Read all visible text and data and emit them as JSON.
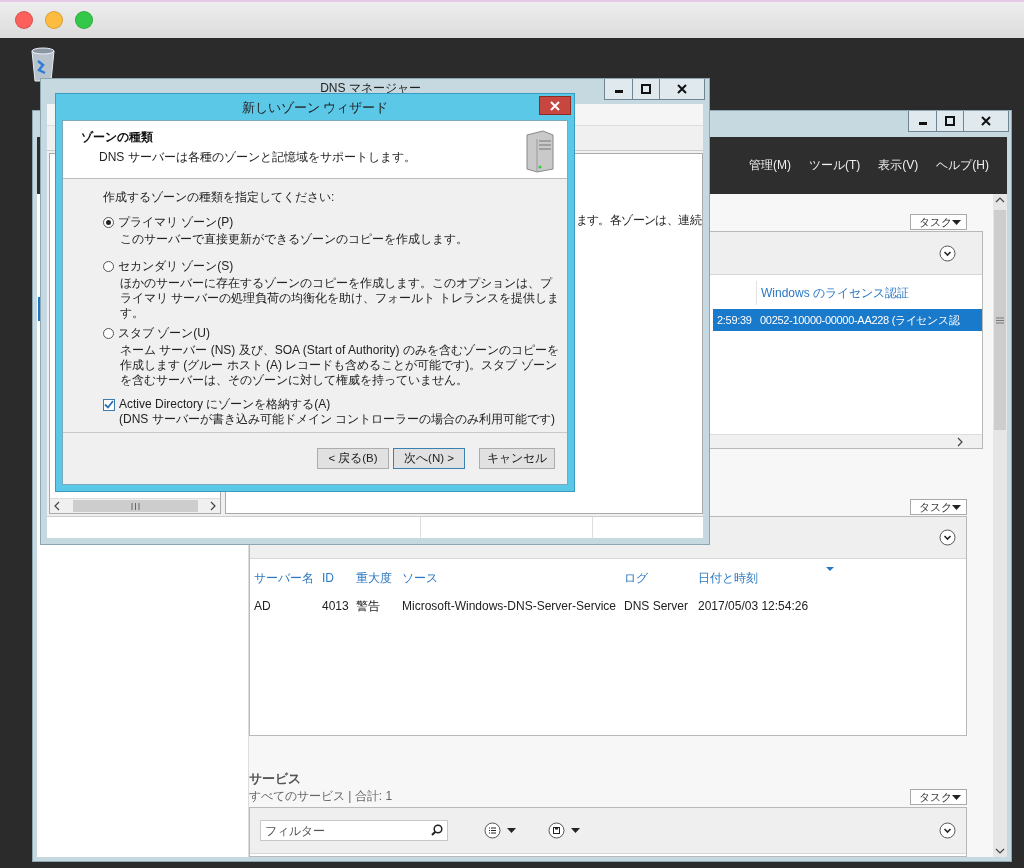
{
  "server_manager": {
    "menu": [
      "管理(M)",
      "ツール(T)",
      "表示(V)",
      "ヘルプ(H)"
    ],
    "license_panel": {
      "task_button": "タスク",
      "columns": [
        "",
        "Windows のライセンス認証"
      ],
      "rows": [
        {
          "cells": [
            "2:59:39",
            "00252-10000-00000-AA228 (ライセンス認"
          ],
          "selected": true
        }
      ]
    },
    "events_panel": {
      "task_button": "タスク",
      "columns": [
        {
          "label": "サーバー名",
          "sorted": false
        },
        {
          "label": "ID",
          "sorted": false
        },
        {
          "label": "重大度",
          "sorted": false
        },
        {
          "label": "ソース",
          "sorted": false
        },
        {
          "label": "ログ",
          "sorted": false
        },
        {
          "label": "日付と時刻",
          "sorted": true
        }
      ],
      "rows": [
        {
          "cells": [
            "AD",
            "4013",
            "警告",
            "Microsoft-Windows-DNS-Server-Service",
            "DNS Server",
            "2017/05/03 12:54:26"
          ],
          "selected": false
        }
      ]
    },
    "services": {
      "title": "サービス",
      "subtitle": "すべてのサービス | 合計: 1",
      "task_button": "タスク",
      "filter": {
        "placeholder": "フィルター"
      }
    }
  },
  "dns_manager": {
    "title": "DNS マネージャー",
    "pane_text": "ます。各ゾーンは、連続"
  },
  "wizard": {
    "title": "新しいゾーン ウィザード",
    "heading": "ゾーンの種類",
    "subheading": "DNS サーバーは各種のゾーンと記憶域をサポートします。",
    "prompt": "作成するゾーンの種類を指定してください:",
    "options": [
      {
        "label": "プライマリ ゾーン(P)",
        "description": "このサーバーで直接更新ができるゾーンのコピーを作成します。",
        "selected": true
      },
      {
        "label": "セカンダリ ゾーン(S)",
        "description": "ほかのサーバーに存在するゾーンのコピーを作成します。このオプションは、プライマリ サーバーの処理負荷の均衡化を助け、フォールト トレランスを提供します。",
        "selected": false
      },
      {
        "label": "スタブ ゾーン(U)",
        "description": "ネーム サーバー (NS) 及び、SOA (Start of Authority) のみを含むゾーンのコピーを作成します (グルー ホスト (A) レコードも含めることが可能です)。スタブ ゾーンを含むサーバーは、そのゾーンに対して権威を持っていません。",
        "selected": false
      }
    ],
    "ad_option": {
      "label": "Active Directory にゾーンを格納する(A)",
      "note": "(DNS サーバーが書き込み可能ドメイン コントローラーの場合のみ利用可能です)",
      "checked": true
    },
    "buttons": [
      {
        "label": "< 戻る(B)",
        "default": false
      },
      {
        "label": "次へ(N) >",
        "default": true
      },
      {
        "label": "キャンセル",
        "default": false
      }
    ]
  }
}
